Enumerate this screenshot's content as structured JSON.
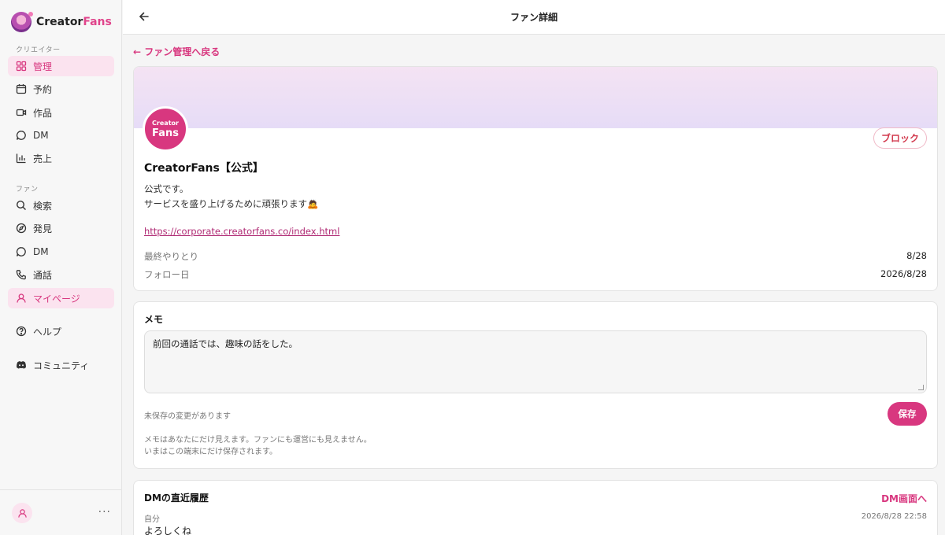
{
  "app": {
    "name_main": "Creator",
    "name_accent": "Fans"
  },
  "sidebar": {
    "creator_label": "クリエイター",
    "creator_items": [
      {
        "label": "管理",
        "icon": "grid-icon",
        "active": true
      },
      {
        "label": "予約",
        "icon": "calendar-icon",
        "active": false
      },
      {
        "label": "作品",
        "icon": "video-icon",
        "active": false
      },
      {
        "label": "DM",
        "icon": "chat-bubble-icon",
        "active": false
      },
      {
        "label": "売上",
        "icon": "bar-chart-icon",
        "active": false
      }
    ],
    "fan_label": "ファン",
    "fan_items": [
      {
        "label": "検索",
        "icon": "search-icon",
        "active": false
      },
      {
        "label": "発見",
        "icon": "compass-icon",
        "active": false
      },
      {
        "label": "DM",
        "icon": "chat-bubble-icon",
        "active": false
      },
      {
        "label": "通話",
        "icon": "phone-icon",
        "active": false
      },
      {
        "label": "マイページ",
        "icon": "user-icon",
        "active": true
      }
    ],
    "help_label": "ヘルプ",
    "community_label": "コミュニティ",
    "footer_more": "···"
  },
  "header": {
    "title": "ファン詳細"
  },
  "back_link": "← ファン管理へ戻る",
  "profile": {
    "avatar_line1": "Creator",
    "avatar_line2": "Fans",
    "block_label": "ブロック",
    "name": "CreatorFans【公式】",
    "bio_line1": "公式です。",
    "bio_line2": "サービスを盛り上げるために頑張ります🙇",
    "url": "https://corporate.creatorfans.co/index.html",
    "last_interaction_label": "最終やりとり",
    "last_interaction_value": "8/28",
    "follow_date_label": "フォロー日",
    "follow_date_value": "2026/8/28"
  },
  "memo": {
    "title": "メモ",
    "value": "前回の通話では、趣味の話をした。",
    "unsaved_text": "未保存の変更があります",
    "save_label": "保存",
    "note_line1": "メモはあなたにだけ見えます。ファンにも運営にも見えません。",
    "note_line2": "いまはこの端末にだけ保存されます。"
  },
  "dm_history": {
    "title": "DMの直近履歴",
    "link_label": "DM画面へ",
    "sender": "自分",
    "time": "2026/8/28 22:58",
    "message": "よろしくね"
  },
  "colors": {
    "accent": "#d8377f",
    "active_bg": "#fbe3ef",
    "block_red": "#d23a4e"
  }
}
